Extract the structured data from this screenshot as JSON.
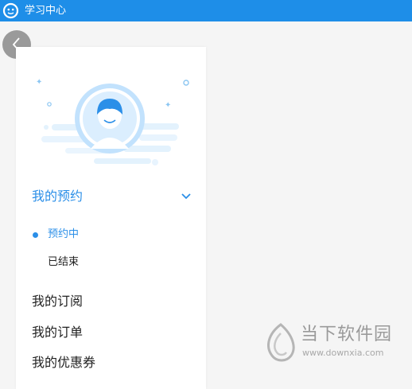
{
  "window": {
    "title": "学习中心"
  },
  "nav": {
    "back_icon": "chevron-left-icon"
  },
  "menu": {
    "section": {
      "label": "我的预约",
      "expanded": true
    },
    "subitems": [
      {
        "label": "预约中",
        "active": true
      },
      {
        "label": "已结束",
        "active": false
      }
    ],
    "items": [
      {
        "label": "我的订阅"
      },
      {
        "label": "我的订单"
      },
      {
        "label": "我的优惠券"
      }
    ]
  },
  "watermark": {
    "brand": "当下软件园",
    "url": "www.downxia.com"
  },
  "colors": {
    "accent": "#1e8ee8",
    "background": "#f5f5f5",
    "panel": "#ffffff",
    "text": "#222222"
  }
}
